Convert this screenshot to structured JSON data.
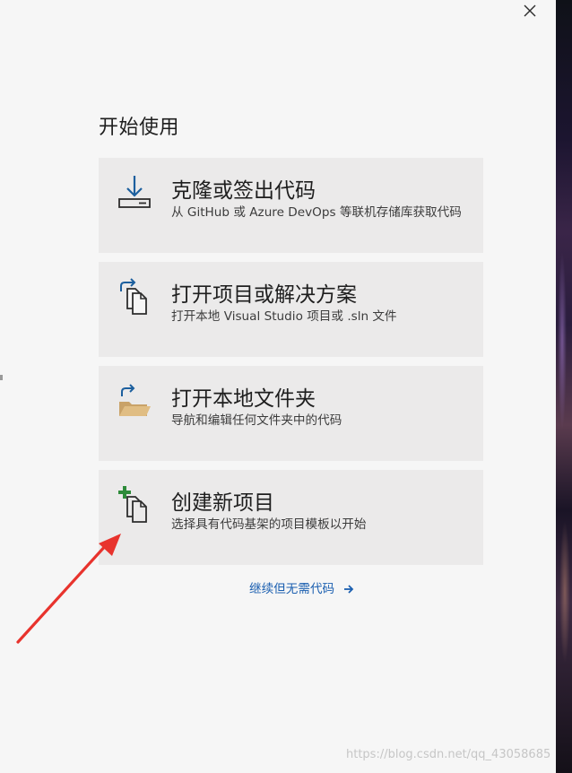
{
  "dialog": {
    "close_label": "close",
    "title": "开始使用"
  },
  "cards": [
    {
      "title": "克隆或签出代码",
      "description": "从 GitHub 或 Azure DevOps 等联机存储库获取代码",
      "icon": "clone-download-icon"
    },
    {
      "title": "打开项目或解决方案",
      "description": "打开本地 Visual Studio 项目或 .sln 文件",
      "icon": "open-project-icon"
    },
    {
      "title": "打开本地文件夹",
      "description": "导航和编辑任何文件夹中的代码",
      "icon": "open-folder-icon"
    },
    {
      "title": "创建新项目",
      "description": "选择具有代码基架的项目模板以开始",
      "icon": "new-project-icon"
    }
  ],
  "continue_link": {
    "label": "继续但无需代码",
    "icon": "arrow-right-icon"
  },
  "watermark": "https://blog.csdn.net/qq_43058685",
  "colors": {
    "dialog_background": "#f6f6f6",
    "card_background": "#ebeaea",
    "link": "#1b5fb0",
    "icon_blue": "#1c5f9e",
    "icon_green": "#2e8b3a",
    "folder": "#dcb67a",
    "annotation_arrow": "#e8332d"
  }
}
